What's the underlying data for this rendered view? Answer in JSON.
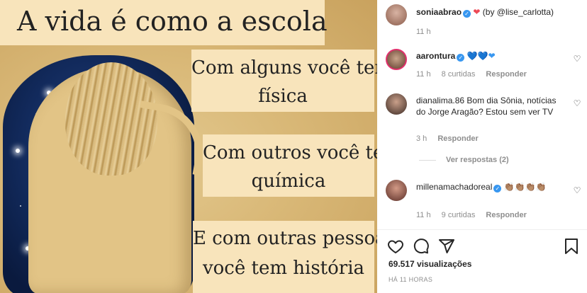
{
  "image": {
    "title": "A vida é como a escola",
    "box1": [
      "Com alguns você tem",
      "física"
    ],
    "box2": [
      "Com outros você tem",
      "química"
    ],
    "box3": [
      "E com outras pessoas",
      "você tem história"
    ]
  },
  "comments": [
    {
      "username": "soniaabrao",
      "verified": true,
      "text": "(by @lise_carlotta)",
      "emojis": "❤",
      "time": "11 h"
    },
    {
      "username": "aarontura",
      "verified": true,
      "emojis": "💙💙❤",
      "time": "11 h",
      "likes": "8 curtidas",
      "reply": "Responder"
    },
    {
      "username": "dianalima.86",
      "text": "Bom dia Sônia, notícias do Jorge Aragão? Estou sem ver TV",
      "time": "3 h",
      "reply": "Responder",
      "view_replies": "Ver respostas (2)"
    },
    {
      "username": "millenamachadoreal",
      "verified": true,
      "emojis": "👏🏽👏🏽👏🏽👏🏽",
      "time": "11 h",
      "likes": "9 curtidas",
      "reply": "Responder"
    }
  ],
  "actions": [
    "heart-outline-icon",
    "comment-icon",
    "share-icon",
    "bookmark-icon"
  ],
  "views": "69.517 visualizações",
  "posted": "HÁ 11 HORAS",
  "colors": {
    "verified": "#3897f0",
    "heart": "#ed4956",
    "text_secondary": "#8e8e8e"
  }
}
